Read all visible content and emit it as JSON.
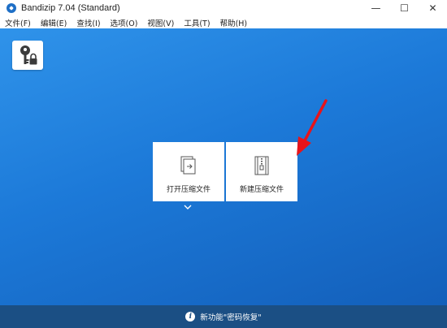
{
  "window": {
    "title": "Bandizip 7.04 (Standard)",
    "controls": {
      "minimize": "—",
      "maximize": "☐",
      "close": "✕"
    }
  },
  "menubar": {
    "items": [
      {
        "label": "文件(F)"
      },
      {
        "label": "编辑(E)"
      },
      {
        "label": "查找(I)"
      },
      {
        "label": "选项(O)"
      },
      {
        "label": "视图(V)"
      },
      {
        "label": "工具(T)"
      },
      {
        "label": "帮助(H)"
      }
    ]
  },
  "main": {
    "password_button_icon": "key-lock-icon",
    "open_archive": {
      "label": "打开压缩文件",
      "icon": "open-file-arrow-icon"
    },
    "new_archive": {
      "label": "新建压缩文件",
      "icon": "zip-file-icon"
    },
    "dropdown_icon": "chevron-down-icon",
    "annotation": {
      "icon": "red-arrow-icon",
      "color": "#e8141a"
    }
  },
  "statusbar": {
    "icon": "info-icon",
    "icon_glyph": "i",
    "text": "新功能\"密码恢复\""
  },
  "colors": {
    "background_top": "#2f93ea",
    "background_bottom": "#135fba",
    "statusbar": "#1b4f84"
  }
}
